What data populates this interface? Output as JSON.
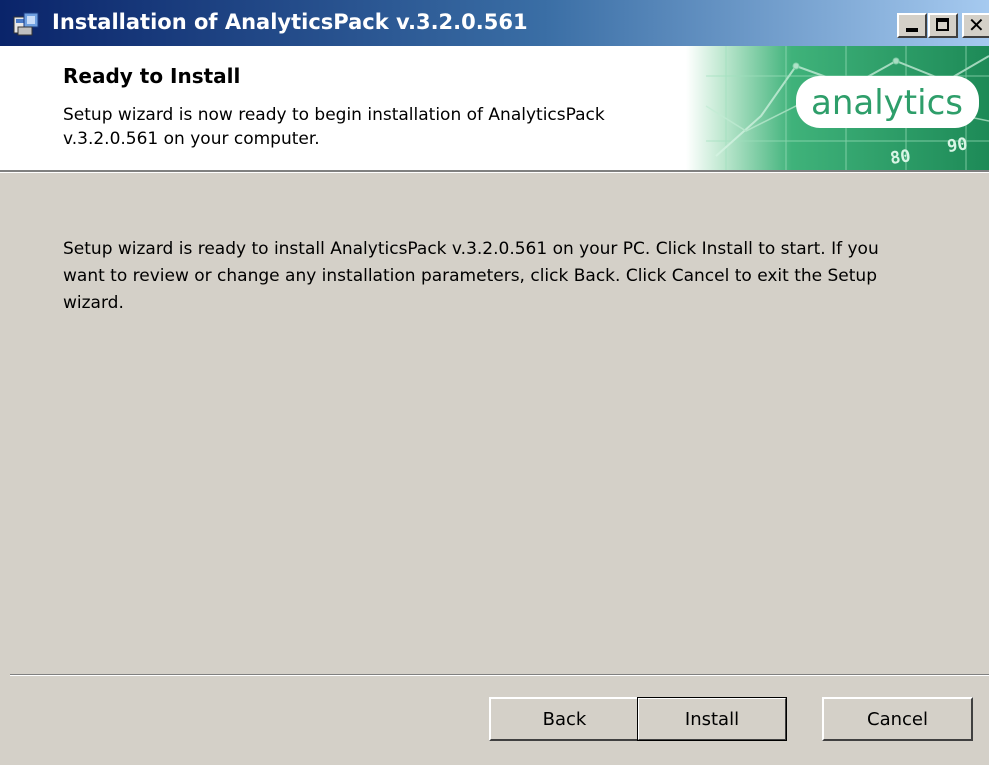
{
  "window": {
    "title": "Installation of AnalyticsPack v.3.2.0.561",
    "controls": {
      "minimize_icon": "minimize-icon",
      "maximize_icon": "maximize-icon",
      "close_icon": "close-icon",
      "close_glyph": "✕"
    }
  },
  "header": {
    "title": "Ready to Install",
    "description": "Setup wizard is now ready to begin installation of AnalyticsPack v.3.2.0.561 on your computer.",
    "logo_text": "analytics",
    "art_numbers": [
      "80",
      "90"
    ]
  },
  "body": {
    "message": "Setup wizard is ready to install AnalyticsPack v.3.2.0.561 on your PC. Click Install to start. If you want to review or change any installation parameters, click Back. Click Cancel to exit the Setup wizard."
  },
  "buttons": {
    "back": "Back",
    "install": "Install",
    "cancel": "Cancel"
  },
  "colors": {
    "titlebar_start": "#0a246a",
    "titlebar_end": "#a6caf0",
    "dialog_bg": "#d4d0c8",
    "logo_green": "#2e9e6a"
  }
}
